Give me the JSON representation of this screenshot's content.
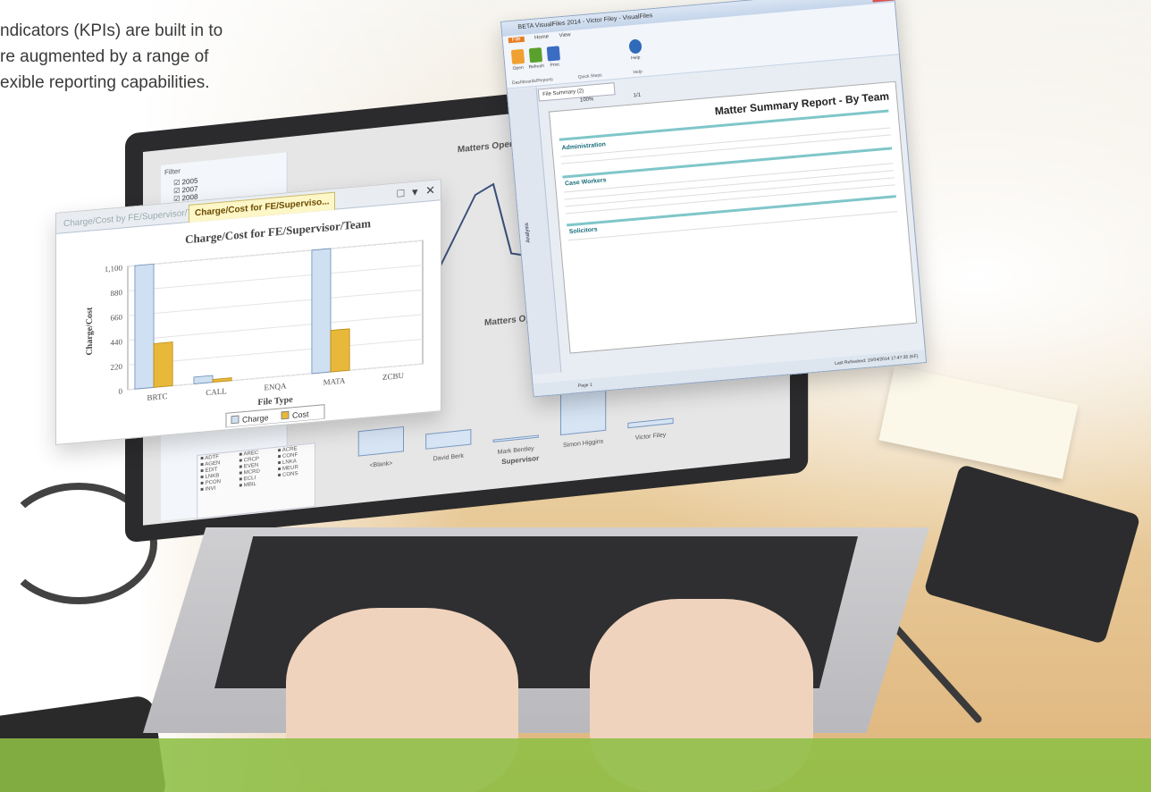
{
  "intro_text": {
    "line1": "ndicators (KPIs) are built in to",
    "line2": "re augmented by a range of",
    "line3": "exible reporting capabilities."
  },
  "chart_window": {
    "tab_inactive": "Charge/Cost  by FE/Supervisor/T...",
    "tab_active": "Charge/Cost  for FE/Supervisо...",
    "controls": [
      "□",
      "▾",
      "✕"
    ]
  },
  "chart_data": {
    "type": "bar",
    "title": "Charge/Cost for FE/Supervisor/Team",
    "xlabel": "File Type",
    "ylabel": "Charge/Cost",
    "categories": [
      "BRTC",
      "CALL",
      "ENQA",
      "MATA",
      "ZCBU"
    ],
    "ylim": [
      0,
      1100
    ],
    "yticks": [
      "0",
      "220",
      "440",
      "660",
      "880",
      "1,100"
    ],
    "series": [
      {
        "name": "Charge",
        "values": [
          1100,
          60,
          0,
          1100,
          0
        ],
        "color": "#cfe0f2"
      },
      {
        "name": "Cost",
        "values": [
          390,
          25,
          0,
          370,
          0
        ],
        "color": "#e8b83a"
      }
    ],
    "legend_position": "bottom"
  },
  "report_window": {
    "title": "BETA  VisualFiles 2014 - Victor Filey - VisualFiles",
    "menu_tabs": [
      "File",
      "Home",
      "View"
    ],
    "buttons": [
      "Open",
      "Refresh",
      "Print",
      "Help"
    ],
    "groups": [
      "Dashboards/Reports",
      "Quick Steps",
      "Help"
    ],
    "doc_tab": "File Summary (2)",
    "zoom": "100%",
    "page_box": "1/1",
    "side_tab": "Analysis",
    "report_title": "Matter Summary Report - By Team",
    "sections": [
      "Administration",
      "Case Workers",
      "Solicitors"
    ],
    "status_page": "Page 1",
    "status_right": "Last Refreshed: 15/04/2014 17:47:35 (KF)"
  },
  "laptop_screen": {
    "filter_label": "Filter",
    "years": [
      "2005",
      "2007",
      "2008"
    ],
    "chart1_title": "Matters Opened",
    "chart2_title": "Matters Opened",
    "chart2_categories": [
      "<Blank>",
      "David Berk",
      "Mark Bentley",
      "Simon Higgins",
      "Victor Filey"
    ],
    "chart2_xlabel": "Supervisor",
    "legend_codes": [
      "ADTF",
      "AREC",
      "ACRE",
      "AGEN",
      "CRCP",
      "CONF",
      "EDIT",
      "EVEN",
      "LNKA",
      "LNKB",
      "MCRD",
      "MEUR",
      "PCON",
      "ECLI",
      "CONS",
      "INVI",
      "MBIL"
    ]
  }
}
